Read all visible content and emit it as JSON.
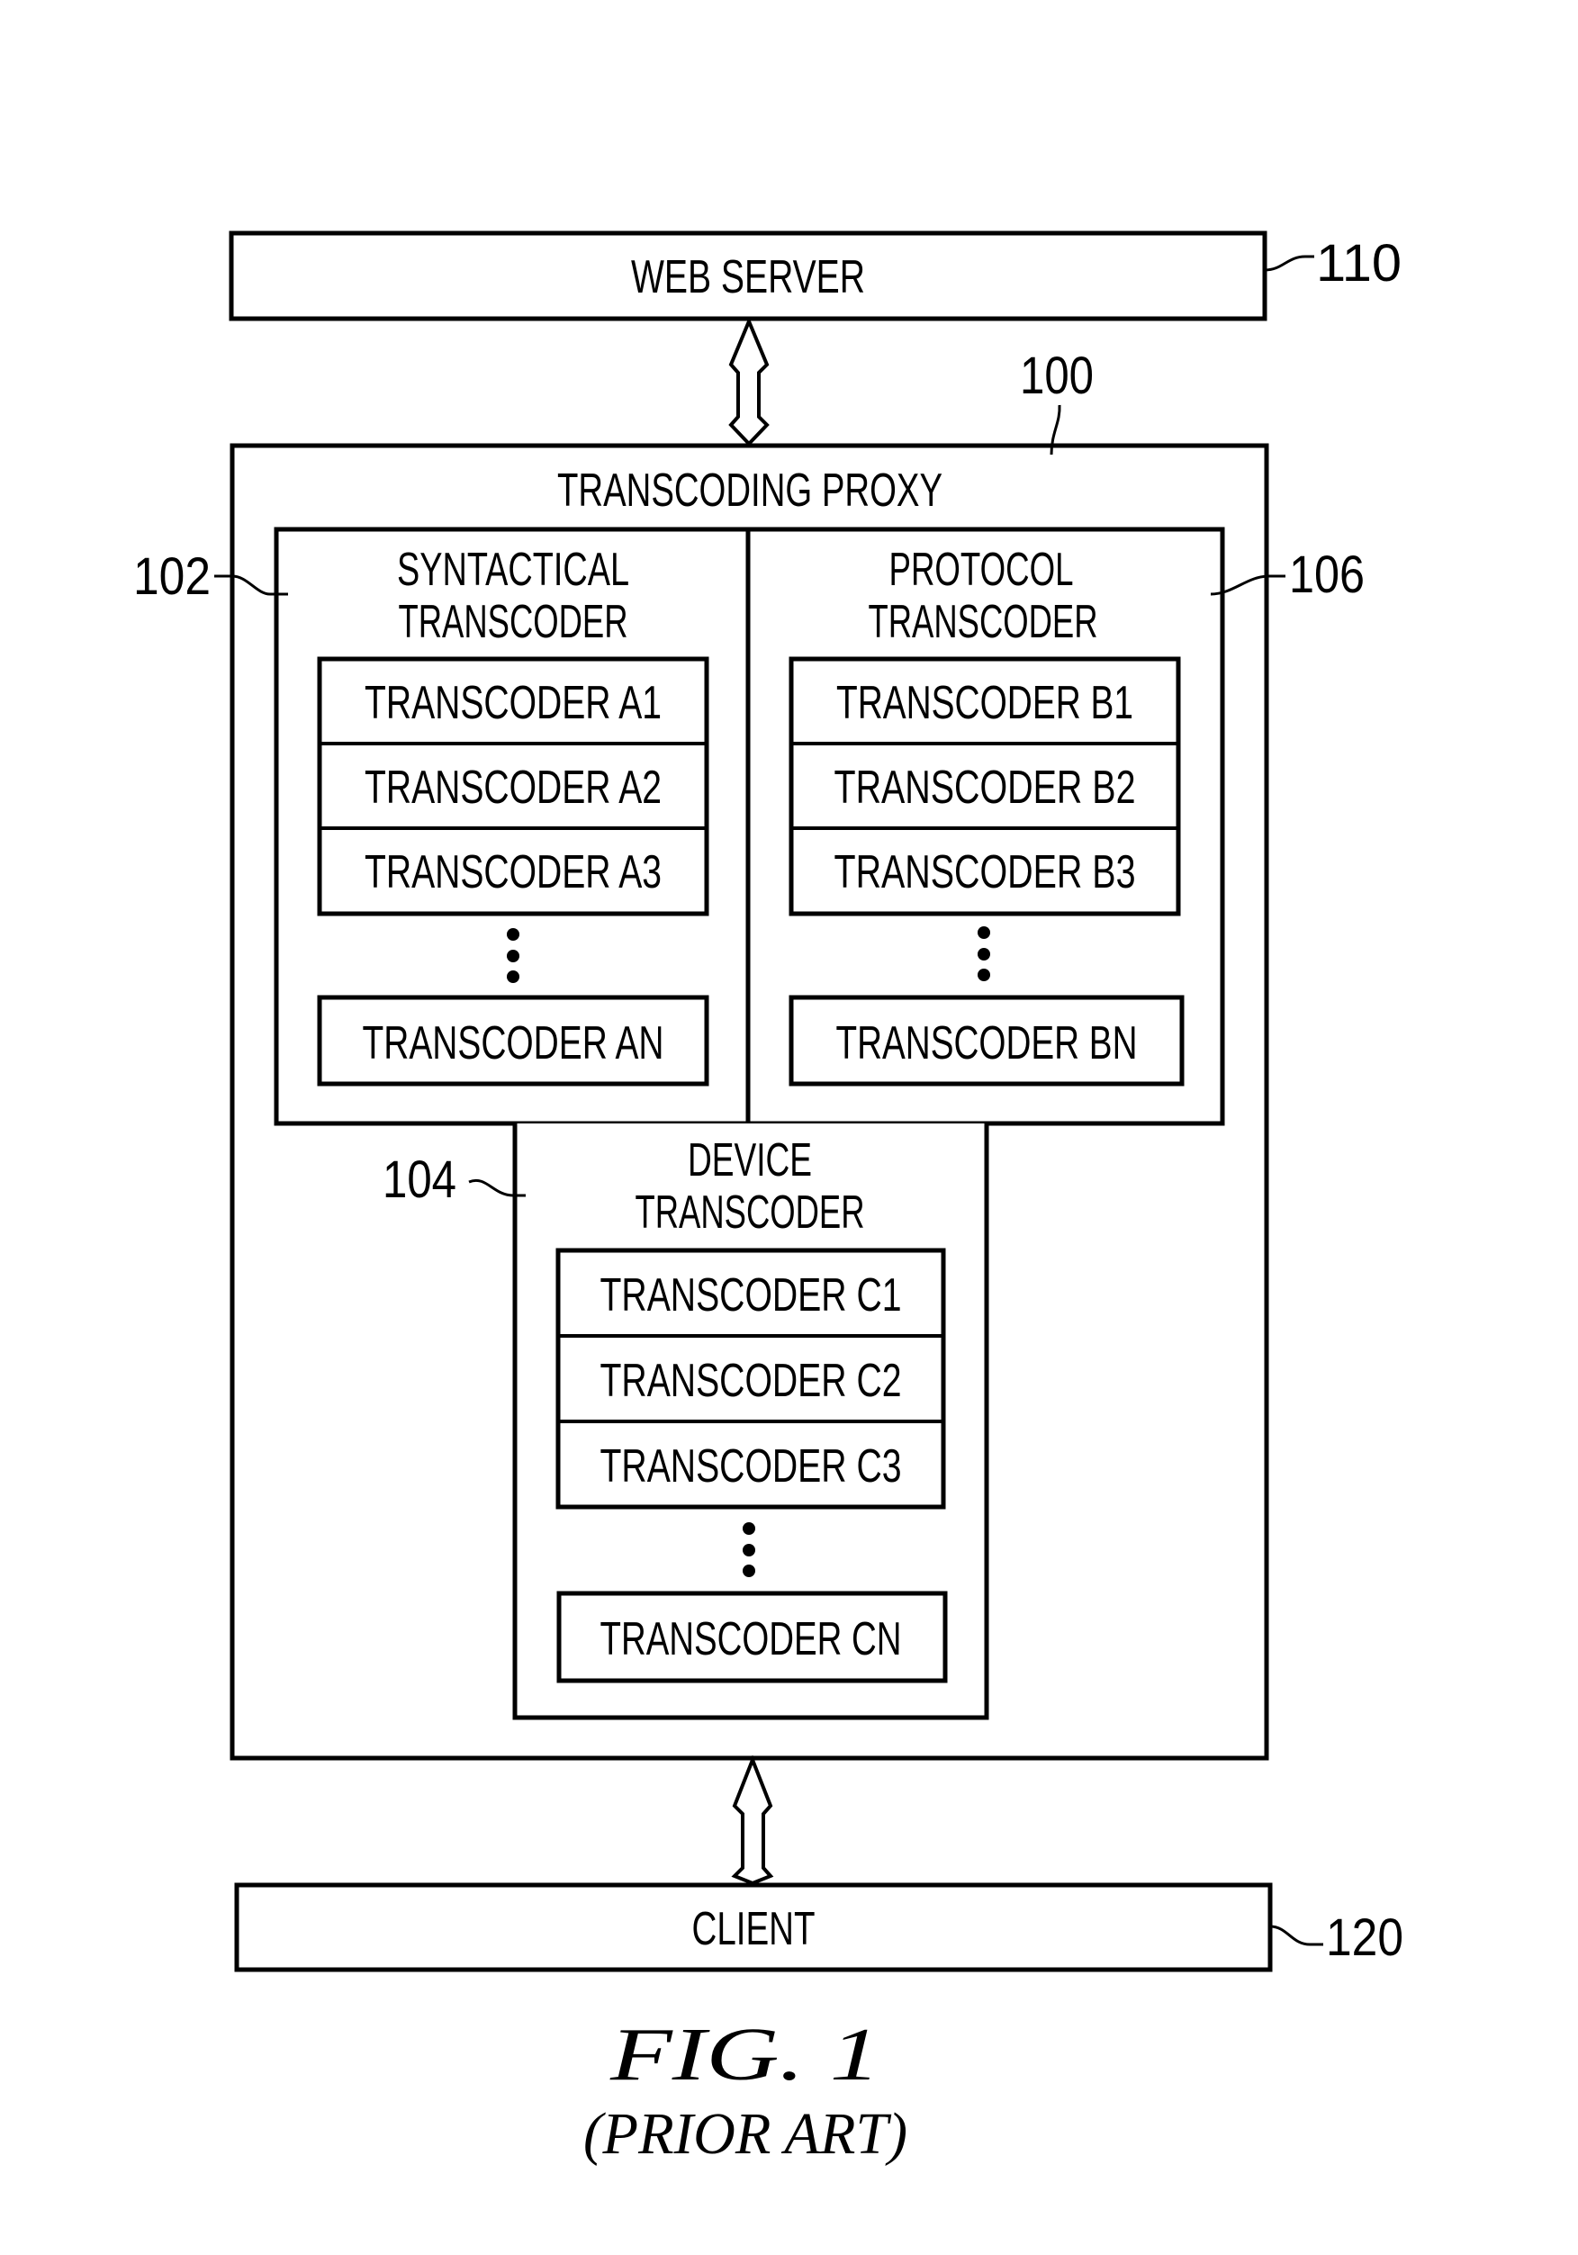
{
  "web_server": {
    "label": "WEB SERVER",
    "ref": "110"
  },
  "proxy": {
    "label": "TRANSCODING PROXY",
    "ref": "100"
  },
  "syntactical": {
    "title_line1": "SYNTACTICAL",
    "title_line2": "TRANSCODER",
    "ref": "102",
    "items": [
      "TRANSCODER A1",
      "TRANSCODER A2",
      "TRANSCODER A3"
    ],
    "last": "TRANSCODER AN"
  },
  "protocol": {
    "title_line1": "PROTOCOL",
    "title_line2": "TRANSCODER",
    "ref": "106",
    "items": [
      "TRANSCODER B1",
      "TRANSCODER B2",
      "TRANSCODER B3"
    ],
    "last": "TRANSCODER BN"
  },
  "device": {
    "title_line1": "DEVICE",
    "title_line2": "TRANSCODER",
    "ref": "104",
    "items": [
      "TRANSCODER C1",
      "TRANSCODER C2",
      "TRANSCODER C3"
    ],
    "last": "TRANSCODER CN"
  },
  "client": {
    "label": "CLIENT",
    "ref": "120"
  },
  "caption": {
    "figure": "FIG.  1",
    "note": "(PRIOR ART)"
  }
}
